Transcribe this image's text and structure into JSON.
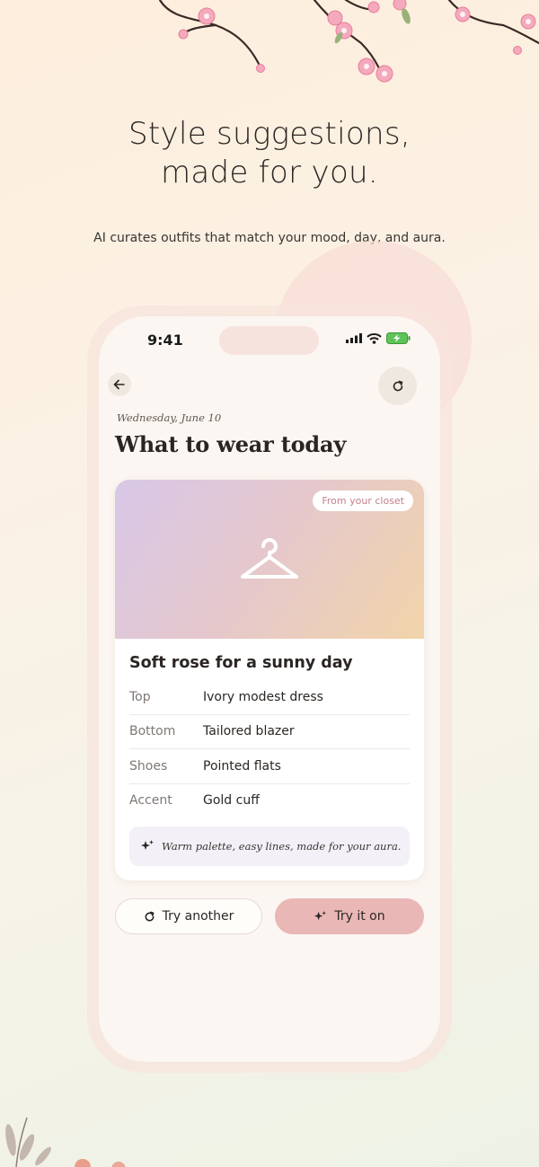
{
  "hero": {
    "title_line1": "Style suggestions,",
    "title_line2": "made for you.",
    "subtitle": "AI curates outfits that match your mood, day, and aura."
  },
  "status_bar": {
    "time": "9:41"
  },
  "header": {
    "date": "Wednesday, June 10",
    "title": "What to wear today"
  },
  "outfit_card": {
    "badge": "From your closet",
    "image_icon": "hanger-icon",
    "title": "Soft rose for a sunny day",
    "items": [
      {
        "label": "Top",
        "value": "Ivory modest dress"
      },
      {
        "label": "Bottom",
        "value": "Tailored blazer"
      },
      {
        "label": "Shoes",
        "value": "Pointed flats"
      },
      {
        "label": "Accent",
        "value": "Gold cuff"
      }
    ],
    "note": "Warm palette, easy lines, made for your aura."
  },
  "actions": {
    "try_another": "Try another",
    "try_it_on": "Try it on"
  },
  "colors": {
    "accent_pink": "#e9b7b6",
    "badge_text": "#c47f8c",
    "note_bg": "#f3f0f7"
  }
}
